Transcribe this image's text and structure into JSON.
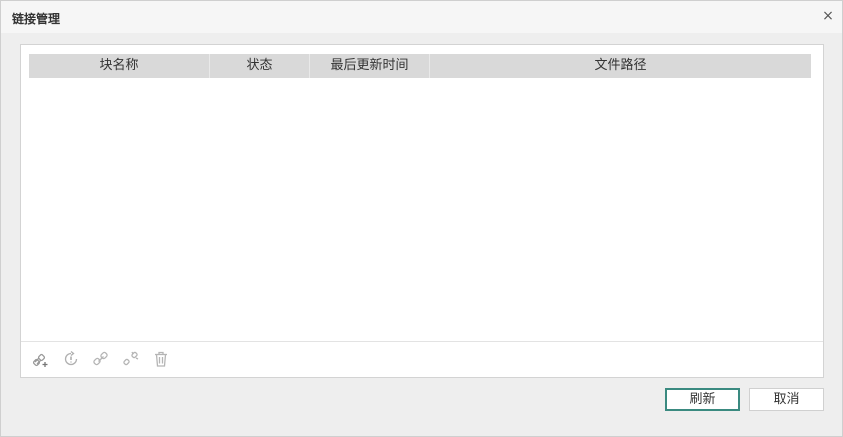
{
  "dialog": {
    "title": "链接管理",
    "close_glyph": "×"
  },
  "table": {
    "columns": [
      "块名称",
      "状态",
      "最后更新时间",
      "文件路径"
    ],
    "rows": []
  },
  "toolbar": {
    "icons": [
      "add-link-icon",
      "reload-link-icon",
      "link-icon",
      "unlink-icon",
      "delete-icon"
    ]
  },
  "buttons": {
    "refresh_label": "刷新",
    "cancel_label": "取消"
  },
  "colors": {
    "accent": "#3a8a80",
    "header_bg": "#d9d9d9",
    "dialog_bg": "#eeeeee"
  }
}
